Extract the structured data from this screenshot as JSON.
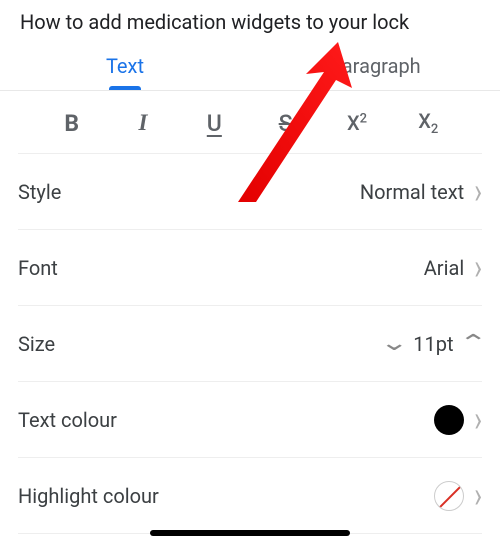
{
  "title": "How to add medication widgets to your lock",
  "tabs": {
    "text": "Text",
    "paragraph": "Paragraph",
    "active": "text"
  },
  "toolbar": {
    "bold": "B",
    "italic": "I",
    "underline": "U",
    "strike": "S",
    "superscript_base": "X",
    "superscript_exp": "2",
    "subscript_base": "X",
    "subscript_exp": "2"
  },
  "rows": {
    "style": {
      "label": "Style",
      "value": "Normal text"
    },
    "font": {
      "label": "Font",
      "value": "Arial"
    },
    "size": {
      "label": "Size",
      "value": "11pt"
    },
    "text_colour": {
      "label": "Text colour",
      "value_hex": "#000000"
    },
    "highlight_colour": {
      "label": "Highlight colour",
      "value": "none"
    }
  }
}
